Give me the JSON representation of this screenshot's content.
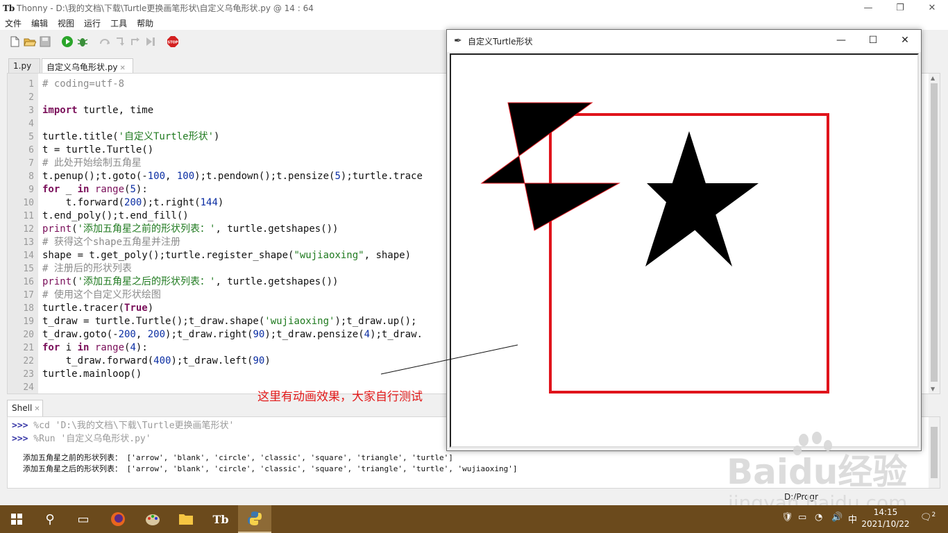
{
  "app": {
    "title": "Thonny  -  D:\\我的文档\\下载\\Turtle更换画笔形状\\自定义乌龟形状.py  @  14 : 64",
    "menu": [
      "文件",
      "编辑",
      "视图",
      "运行",
      "工具",
      "帮助"
    ]
  },
  "toolbar": {
    "icons": [
      "new-file-icon",
      "open-file-icon",
      "save-file-icon",
      "run-icon",
      "debug-icon",
      "step-over-icon",
      "step-into-icon",
      "step-out-icon",
      "resume-icon",
      "stop-icon"
    ],
    "stop_label": "STOP"
  },
  "tabs": [
    {
      "label": "1.py"
    },
    {
      "label": "自定义乌龟形状.py"
    }
  ],
  "editor": {
    "line_numbers": [
      "1",
      "2",
      "3",
      "4",
      "5",
      "6",
      "7",
      "8",
      "9",
      "10",
      "11",
      "12",
      "13",
      "14",
      "15",
      "16",
      "17",
      "18",
      "19",
      "20",
      "21",
      "22",
      "23",
      "24"
    ],
    "lines": [
      "# coding=utf-8",
      "",
      "import turtle, time",
      "",
      "turtle.title('自定义Turtle形状')",
      "t = turtle.Turtle()",
      "# 此处开始绘制五角星",
      "t.penup();t.goto(-100, 100);t.pendown();t.pensize(5);turtle.trace",
      "for _ in range(5):",
      "    t.forward(200);t.right(144)",
      "t.end_poly();t.end_fill()",
      "print('添加五角星之前的形状列表：', turtle.getshapes())",
      "# 获得这个shape五角星并注册",
      "shape = t.get_poly();turtle.register_shape(\"wujiaoxing\", shape)",
      "# 注册后的形状列表",
      "print('添加五角星之后的形状列表：', turtle.getshapes())",
      "# 使用这个自定义形状绘图",
      "turtle.tracer(True)",
      "t_draw = turtle.Turtle();t_draw.shape('wujiaoxing');t_draw.up();",
      "t_draw.goto(-200, 200);t_draw.right(90);t_draw.pensize(4);t_draw.",
      "for i in range(4):",
      "    t_draw.forward(400);t_draw.left(90)",
      "turtle.mainloop()",
      ""
    ]
  },
  "annotation": "这里有动画效果，大家自行测试",
  "shell": {
    "tab_label": "Shell",
    "commands": [
      {
        "prompt": ">>>",
        "text": " %cd 'D:\\我的文档\\下载\\Turtle更换画笔形状'"
      },
      {
        "prompt": ">>>",
        "text": " %Run '自定义乌龟形状.py'"
      }
    ],
    "output": [
      "添加五角星之前的形状列表： ['arrow', 'blank', 'circle', 'classic', 'square', 'triangle', 'turtle']",
      "添加五角星之后的形状列表： ['arrow', 'blank', 'circle', 'classic', 'square', 'triangle', 'turtle', 'wujiaoxing']"
    ]
  },
  "status": {
    "text": "D:/Progr"
  },
  "turtle_window": {
    "title": "自定义Turtle形状",
    "colors": {
      "square": "#e0141c",
      "star": "#000000",
      "star_outline": "#e0141c"
    }
  },
  "watermark": {
    "brand": "Baidu经验",
    "site": "jingyan.baidu.com"
  },
  "taskbar": {
    "apps": [
      "start-icon",
      "search-icon",
      "task-view-icon",
      "firefox-icon",
      "paint-icon",
      "file-explorer-icon",
      "thonny-icon",
      "python-icon"
    ],
    "ime": "中",
    "time": "14:15",
    "date": "2021/10/22",
    "notifications": "2"
  }
}
